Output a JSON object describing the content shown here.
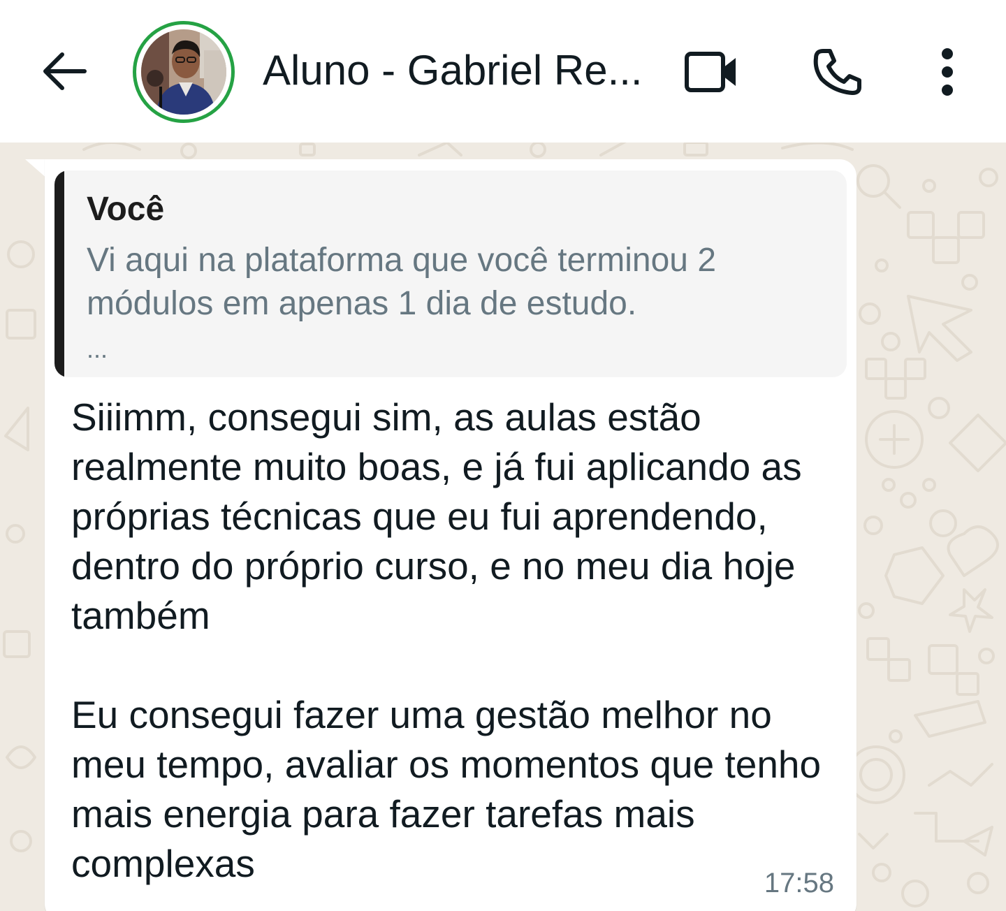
{
  "header": {
    "contact_name": "Aluno - Gabriel Re...",
    "back_icon": "arrow-left-icon",
    "video_icon": "video-camera-icon",
    "call_icon": "phone-icon",
    "menu_icon": "more-vertical-icon",
    "avatar_ring_color": "#25a244"
  },
  "message": {
    "quoted": {
      "author": "Você",
      "text": "Vi aqui na plataforma que você terminou 2 módulos em apenas 1 dia de estudo.",
      "more": "..."
    },
    "text": "Siiimm, consegui sim, as aulas estão realmente muito boas, e já fui aplicando as próprias técnicas que eu fui aprendendo, dentro do próprio curso, e no meu dia hoje também\n\nEu consegui fazer uma gestão melhor no meu tempo, avaliar os momentos que tenho mais energia para fazer tarefas mais complexas",
    "time": "17:58"
  },
  "colors": {
    "chat_background": "#efeae2",
    "bubble_background": "#ffffff",
    "quote_background": "#f5f5f5",
    "text": "#111b21",
    "secondary_text": "#667781"
  }
}
